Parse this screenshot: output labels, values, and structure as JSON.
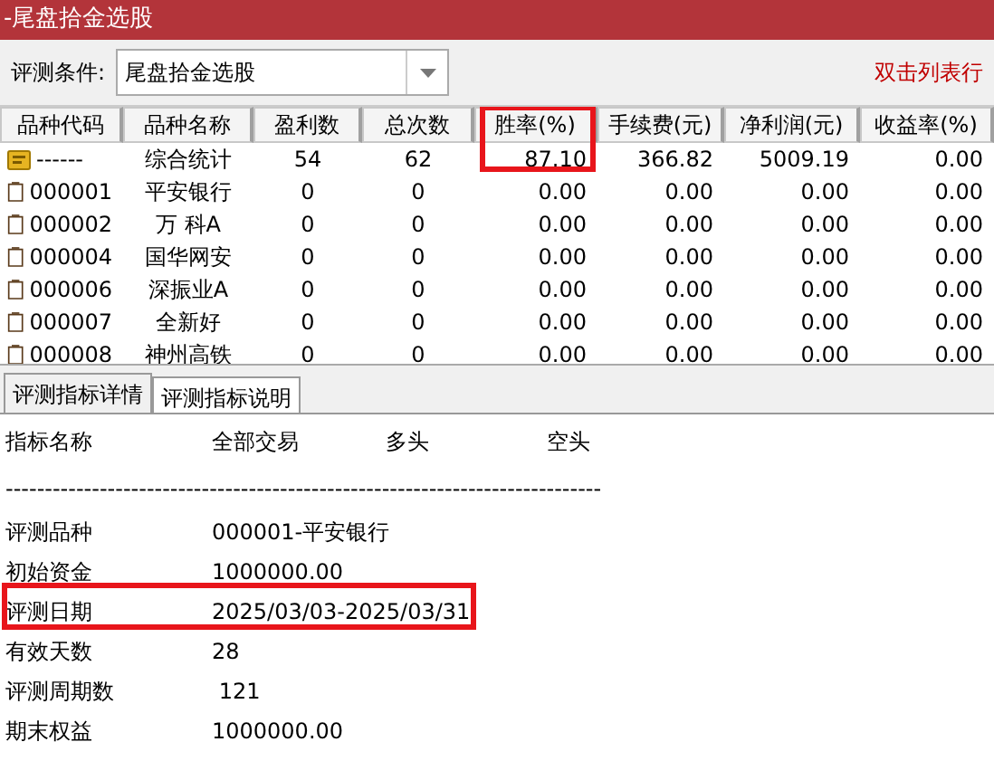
{
  "window": {
    "title": "-尾盘拾金选股"
  },
  "toolbar": {
    "label": "评测条件:",
    "condition": "尾盘拾金选股",
    "hint": "双击列表行"
  },
  "table": {
    "columns": [
      {
        "label": "品种代码",
        "highlighted": false
      },
      {
        "label": "品种名称",
        "highlighted": false
      },
      {
        "label": "盈利数",
        "highlighted": false
      },
      {
        "label": "总次数",
        "highlighted": false
      },
      {
        "label": "胜率(%)",
        "highlighted": true
      },
      {
        "label": "手续费(元)",
        "highlighted": false
      },
      {
        "label": "净利润(元)",
        "highlighted": false
      },
      {
        "label": "收益率(%)",
        "highlighted": false
      }
    ],
    "rows": [
      {
        "kind": "summary",
        "cells": [
          "------",
          "综合统计",
          "54",
          "62",
          "87.10",
          "366.82",
          "5009.19",
          "0.00"
        ]
      },
      {
        "kind": "stock",
        "cells": [
          "000001",
          "平安银行",
          "0",
          "0",
          "0.00",
          "0.00",
          "0.00",
          "0.00"
        ]
      },
      {
        "kind": "stock",
        "cells": [
          "000002",
          "万 科A",
          "0",
          "0",
          "0.00",
          "0.00",
          "0.00",
          "0.00"
        ]
      },
      {
        "kind": "stock",
        "cells": [
          "000004",
          "国华网安",
          "0",
          "0",
          "0.00",
          "0.00",
          "0.00",
          "0.00"
        ]
      },
      {
        "kind": "stock",
        "cells": [
          "000006",
          "深振业A",
          "0",
          "0",
          "0.00",
          "0.00",
          "0.00",
          "0.00"
        ]
      },
      {
        "kind": "stock",
        "cells": [
          "000007",
          "全新好",
          "0",
          "0",
          "0.00",
          "0.00",
          "0.00",
          "0.00"
        ]
      },
      {
        "kind": "stock",
        "cells": [
          "000008",
          "神州高铁",
          "0",
          "0",
          "0.00",
          "0.00",
          "0.00",
          "0.00"
        ]
      }
    ]
  },
  "tabs": [
    {
      "label": "评测指标详情",
      "selected": true
    },
    {
      "label": "评测指标说明",
      "selected": false
    }
  ],
  "details": {
    "headers": [
      "指标名称",
      "全部交易",
      "多头",
      "空头"
    ],
    "separator": "----------------------------------------------------------------------------",
    "rows": [
      {
        "label": "评测品种",
        "value": "000001-平安银行",
        "highlighted": false
      },
      {
        "label": "初始资金",
        "value": "1000000.00",
        "highlighted": false
      },
      {
        "label": "评测日期",
        "value": "2025/03/03-2025/03/31",
        "highlighted": true
      },
      {
        "label": "有效天数",
        "value": "28",
        "highlighted": false
      },
      {
        "label": "评测周期数",
        "value": " 121",
        "highlighted": false
      },
      {
        "label": "期末权益",
        "value": "1000000.00",
        "highlighted": false
      }
    ]
  }
}
